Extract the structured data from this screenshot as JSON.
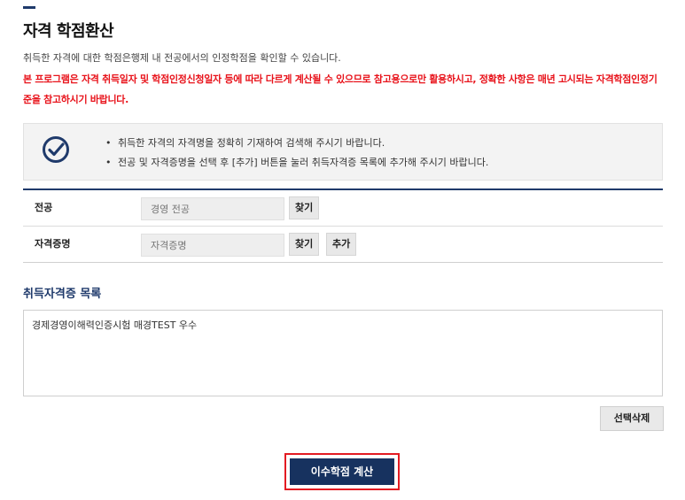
{
  "page": {
    "title": "자격 학점환산",
    "description": "취득한 자격에 대한 학점은행제 내 전공에서의 인정학점을 확인할 수 있습니다.",
    "warning": "본 프로그램은 자격 취득일자 및 학점인정신청일자 등에 따라 다르게 계산될 수 있으므로 참고용으로만 활용하시고, 정확한 사항은 매년 고시되는 자격학점인정기준을 참고하시기 바랍니다."
  },
  "info": {
    "icon": "check-circle-icon",
    "items": [
      "취득한 자격의 자격명을 정확히 기재하여 검색해 주시기 바랍니다.",
      "전공 및 자격증명을 선택 후 [추가] 버튼을 눌러 취득자격증 목록에 추가해 주시기 바랍니다."
    ]
  },
  "form": {
    "major": {
      "label": "전공",
      "placeholder": "경영 전공",
      "value": "",
      "find_label": "찾기"
    },
    "certificate": {
      "label": "자격증명",
      "placeholder": "자격증명",
      "value": "",
      "find_label": "찾기",
      "add_label": "추가"
    }
  },
  "acquired": {
    "title": "취득자격증 목록",
    "items": [
      "경제경영이해력인증시험 매경TEST 우수"
    ],
    "delete_label": "선택삭제"
  },
  "calculate": {
    "label": "이수학점 계산"
  },
  "colors": {
    "navy": "#1f3a6b",
    "warning_red": "#e8121a",
    "highlight_red": "#e31b22",
    "button_navy": "#17325f"
  }
}
